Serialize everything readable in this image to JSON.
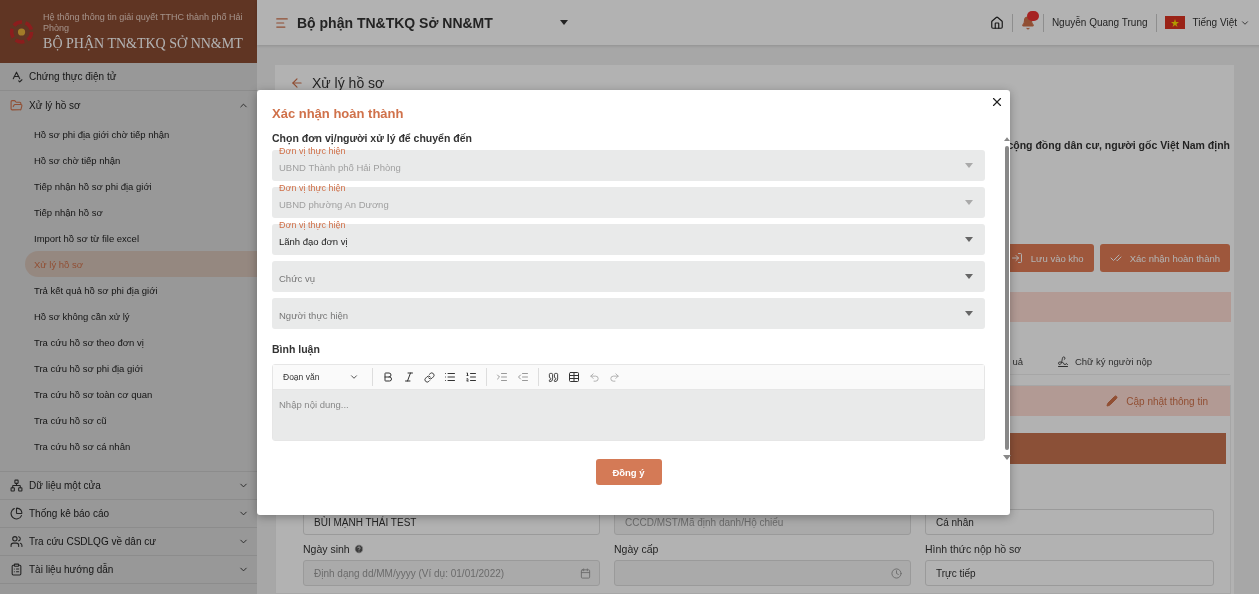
{
  "sidebar": {
    "brand": {
      "subtitle": "Hệ thống thông tin giải quyết TTHC thành phố Hải Phòng",
      "title": "BỘ PHẬN TN&TKQ SỞ NN&MT"
    },
    "sections": [
      {
        "kind": "link",
        "label": "Chứng thực điện tử"
      },
      {
        "kind": "group",
        "label": "Xử lý hồ sơ",
        "expanded": true,
        "children": [
          {
            "label": "Hồ sơ phi địa giới chờ tiếp nhận",
            "selected": false
          },
          {
            "label": "Hồ sơ chờ tiếp nhận",
            "selected": false
          },
          {
            "label": "Tiếp nhận hồ sơ phi địa giới",
            "selected": false
          },
          {
            "label": "Tiếp nhận hồ sơ",
            "selected": false
          },
          {
            "label": "Import hồ sơ từ file excel",
            "selected": false
          },
          {
            "label": "Xử lý hồ sơ",
            "selected": true
          },
          {
            "label": "Trả kết quả hồ sơ phi địa giới",
            "selected": false
          },
          {
            "label": "Hồ sơ không cần xử lý",
            "selected": false
          },
          {
            "label": "Tra cứu hồ sơ theo đơn vị",
            "selected": false
          },
          {
            "label": "Tra cứu hồ sơ phi địa giới",
            "selected": false
          },
          {
            "label": "Tra cứu hồ sơ toàn cơ quan",
            "selected": false
          },
          {
            "label": "Tra cứu hồ sơ cũ",
            "selected": false
          },
          {
            "label": "Tra cứu hồ sơ cá nhân",
            "selected": false
          }
        ]
      },
      {
        "kind": "group",
        "label": "Dữ liệu một cửa",
        "expanded": false
      },
      {
        "kind": "group",
        "label": "Thống kê báo cáo",
        "expanded": false
      },
      {
        "kind": "group",
        "label": "Tra cứu CSDLQG về dân cư",
        "expanded": false
      },
      {
        "kind": "group",
        "label": "Tài liệu hướng dẫn",
        "expanded": false
      }
    ]
  },
  "header": {
    "unit": "Bộ phận TN&TKQ Sở NN&MT",
    "user": "Nguyễn Quang Trung",
    "language": "Tiếng Việt"
  },
  "page": {
    "title": "Xử lý hồ sơ",
    "description": "cộng đồng dân cư, người gốc Việt Nam định",
    "actions": [
      {
        "kind": "store",
        "label": "Lưu vào kho"
      },
      {
        "kind": "complete",
        "label": "Xác nhận hoàn thành"
      }
    ],
    "tabs": [
      {
        "label": "uả"
      },
      {
        "label": "Chữ ký người nộp"
      }
    ],
    "update_button": "Cập nhật thông tin",
    "fields": [
      {
        "kind": "text",
        "value": "BÙI MẠNH THÁI TEST"
      },
      {
        "kind": "text",
        "placeholder": "CCCD/MST/Mã định danh/Hộ chiếu"
      },
      {
        "kind": "text",
        "value": "Cá nhân"
      },
      {
        "kind": "date",
        "label": "Ngày sinh",
        "help": true,
        "placeholder": "Định dạng dd/MM/yyyy (Ví dụ: 01/01/2022)"
      },
      {
        "kind": "time",
        "label": "Ngày cấp",
        "help": false
      },
      {
        "kind": "text",
        "label": "Hình thức nộp hồ sơ",
        "help": false,
        "value": "Trực tiếp"
      }
    ]
  },
  "modal": {
    "title": "Xác nhận hoàn thành",
    "section_label": "Chọn đơn vị/người xử lý để chuyển đến",
    "selects": [
      {
        "label": "Đơn vị thực hiện",
        "value": "UBND Thành phố Hải Phòng",
        "disabled": true
      },
      {
        "label": "Đơn vị thực hiện",
        "value": "UBND phường An Dương",
        "disabled": true
      },
      {
        "label": "Đơn vị thực hiện",
        "value": "Lãnh đạo đơn vị",
        "disabled": false
      },
      {
        "placeholder": "Chức vụ",
        "disabled": false
      },
      {
        "placeholder": "Người thực hiện",
        "disabled": false
      }
    ],
    "comment_label": "Bình luận",
    "editor": {
      "format": "Đoạn văn",
      "placeholder": "Nhập nội dung..."
    },
    "submit": "Đồng ý"
  }
}
